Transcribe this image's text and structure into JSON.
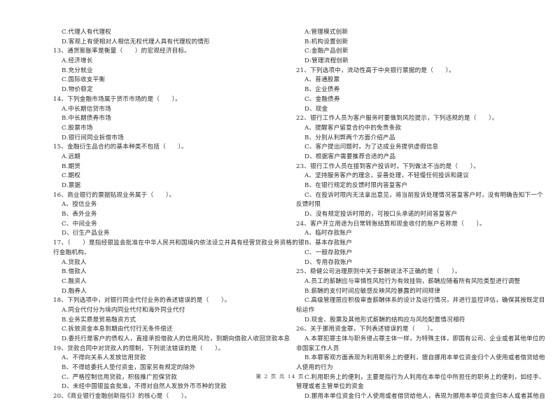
{
  "left_column": [
    {
      "kind": "opt",
      "text": "C.代理人有代理权"
    },
    {
      "kind": "opt",
      "text": "D.客观上有使相对人相信无权代理人具有代理权的情形"
    },
    {
      "kind": "q",
      "text": "13、通货膨胀率是衡量（　　）的宏观经济目标。"
    },
    {
      "kind": "opt",
      "text": "A.经济增长"
    },
    {
      "kind": "opt",
      "text": "B.充分就业"
    },
    {
      "kind": "opt",
      "text": "C.国际收支平衡"
    },
    {
      "kind": "opt",
      "text": "D.物价稳定"
    },
    {
      "kind": "q",
      "text": "14、下列金融市场属于货币市场的是（　　）。"
    },
    {
      "kind": "opt",
      "text": "A.中长期信贷市场"
    },
    {
      "kind": "opt",
      "text": "B.中长期债券市场"
    },
    {
      "kind": "opt",
      "text": "C.股票市场"
    },
    {
      "kind": "opt",
      "text": "D.银行间同业拆借市场"
    },
    {
      "kind": "q",
      "text": "15、金融衍生品合约的基本种类不包括（　　）。"
    },
    {
      "kind": "opt",
      "text": "A.远期"
    },
    {
      "kind": "opt",
      "text": "B.期货"
    },
    {
      "kind": "opt",
      "text": "C.期权"
    },
    {
      "kind": "opt",
      "text": "D.票据"
    },
    {
      "kind": "q",
      "text": "16、商业银行的票据贴现业务属于（　　）。"
    },
    {
      "kind": "opt",
      "text": "A、授信业务"
    },
    {
      "kind": "opt",
      "text": "B、表外业务"
    },
    {
      "kind": "opt",
      "text": "C、中间业务"
    },
    {
      "kind": "opt",
      "text": "D、衍生产品业务"
    },
    {
      "kind": "q",
      "text": "17、（　　）是指经银监会批准在中华人民共和国境内依法设立并具有经营贷款业务资格的银"
    },
    {
      "kind": "cont",
      "text": "行金融机构。"
    },
    {
      "kind": "opt",
      "text": "A.贷款人"
    },
    {
      "kind": "opt",
      "text": "B.借款人"
    },
    {
      "kind": "opt",
      "text": "C.融资人"
    },
    {
      "kind": "opt",
      "text": "D.融券人"
    },
    {
      "kind": "q",
      "text": "18、下列选项中，对银行同业代付业务的表述错误的是（　　）。"
    },
    {
      "kind": "opt",
      "text": "A.同业代付分为境内同业代付和海外同业代付"
    },
    {
      "kind": "opt",
      "text": "B.业务实质是贸易融资方式"
    },
    {
      "kind": "opt",
      "text": "C.拆放资金本息到期由代付行无条件偿还"
    },
    {
      "kind": "opt",
      "text": "D.委托行是客户的债权人，直接承担借款人的信用风险，到期向借款人收回贷款本息"
    },
    {
      "kind": "q",
      "text": "19、贷款合同中对贷款人的限制，下列说法错误的是（　　）。"
    },
    {
      "kind": "opt",
      "text": "A、不得向关系人发放信用贷款"
    },
    {
      "kind": "opt",
      "text": "B、不得给委托人垫付资金，国家另有规定的除外"
    },
    {
      "kind": "opt",
      "text": "C、严格控制信用贷款，积极推广担保贷款"
    },
    {
      "kind": "opt",
      "text": "D、未经中国银监会批准，不得对自然人发放外币币种的贷款"
    },
    {
      "kind": "q",
      "text": "20、《商业银行金融创新指引》的核心是（　　）。"
    }
  ],
  "right_column": [
    {
      "kind": "opt",
      "text": "A:管理模式创新"
    },
    {
      "kind": "opt",
      "text": "B:机构设置创新"
    },
    {
      "kind": "opt",
      "text": "C:金融产品创新"
    },
    {
      "kind": "opt",
      "text": "D:管理流程创新"
    },
    {
      "kind": "q",
      "text": "21、下列选项中，流动性高于中央银行票据的是（　　）。"
    },
    {
      "kind": "opt",
      "text": "A、普通股票"
    },
    {
      "kind": "opt",
      "text": "B、企业债券"
    },
    {
      "kind": "opt",
      "text": "C、金融债券"
    },
    {
      "kind": "opt",
      "text": "D、现金"
    },
    {
      "kind": "q",
      "text": "22、银行工作人员为客户服务时要做到风险提示，下列违规的是（　　）。"
    },
    {
      "kind": "opt",
      "text": "A、提醒客户留意合约中的免责条款"
    },
    {
      "kind": "opt",
      "text": "B、分别从利弊两个方面介绍产品"
    },
    {
      "kind": "opt",
      "text": "C、客户提出问题时，为了达成业务提供虚假信息"
    },
    {
      "kind": "opt",
      "text": "D、根据客户需要推荐合适的产品"
    },
    {
      "kind": "q",
      "text": "23、银行工作人员在接到客户投诉时，下列做法不当的是（　　）。"
    },
    {
      "kind": "opt",
      "text": "A、坚持服务客户的理念，妥善处理，不轻慢任何投诉和建议"
    },
    {
      "kind": "opt",
      "text": "B、在银行规定的反馈时限内答复客户"
    },
    {
      "kind": "opt",
      "text": "C、在投诉时限内无法拿出意见，将当前投诉处理情况答复客户时，没有明确告知下一个"
    },
    {
      "kind": "cont",
      "text": "反馈时限"
    },
    {
      "kind": "opt",
      "text": "D、没有规定投诉时限的，可按口头承诺的时间答复客户"
    },
    {
      "kind": "q",
      "text": "24、客户开立用途为日常转账结算和现金收付的账户名称是（　　）。"
    },
    {
      "kind": "opt",
      "text": "A、临时存款账户"
    },
    {
      "kind": "opt",
      "text": "B、基本存款账户"
    },
    {
      "kind": "opt",
      "text": "C、一般存款账户"
    },
    {
      "kind": "opt",
      "text": "D、专用存款账户"
    },
    {
      "kind": "q",
      "text": "25、稳健公司治理原则中关于薪酬说法不正确的是（　　）。"
    },
    {
      "kind": "opt",
      "text": "A.员工的薪酬应与审慎性风险行为有效挂钩，薪酬应随着所有风险类型进行调整"
    },
    {
      "kind": "opt",
      "text": "B.薪酬的支付时间应敏感反映风险暴露的时间规律"
    },
    {
      "kind": "opt",
      "text": "C.高级管理层应积极审查薪酬体系的设计及运行情况，并进行监控评估，确保其按既定目"
    },
    {
      "kind": "cont",
      "text": "标运作"
    },
    {
      "kind": "opt",
      "text": "D.现金、股票及其他形式薪酬的结构应与风险配置情况相符"
    },
    {
      "kind": "q",
      "text": "26、关于挪用资金罪，下列表述错误的是（　　）。"
    },
    {
      "kind": "opt",
      "text": "A.本罪犯罪主体与职务侵占罪主体一样，为特殊主体，即国有公司、企业或者其他单位的"
    },
    {
      "kind": "cont",
      "text": "非国家工作人员"
    },
    {
      "kind": "opt",
      "text": "B.本罪客观方面表现为利用职务上的便利，擅自挪用本单位资金归个人使用或者借贷给他"
    },
    {
      "kind": "cont",
      "text": "人使用的行为"
    },
    {
      "kind": "opt",
      "text": "C.利用职务上的便利，主要是指行为人利用在本单位中所担任的职务上的便利，如经手、"
    },
    {
      "kind": "cont",
      "text": "管理或者主管单位的资金"
    },
    {
      "kind": "opt",
      "text": "D.挪用本单位资金归个人使用或者借贷给他人，表现为挪用本单位资金归本人或者其他自"
    }
  ],
  "footer": {
    "page_label": "第 2 页 共 14 页"
  }
}
